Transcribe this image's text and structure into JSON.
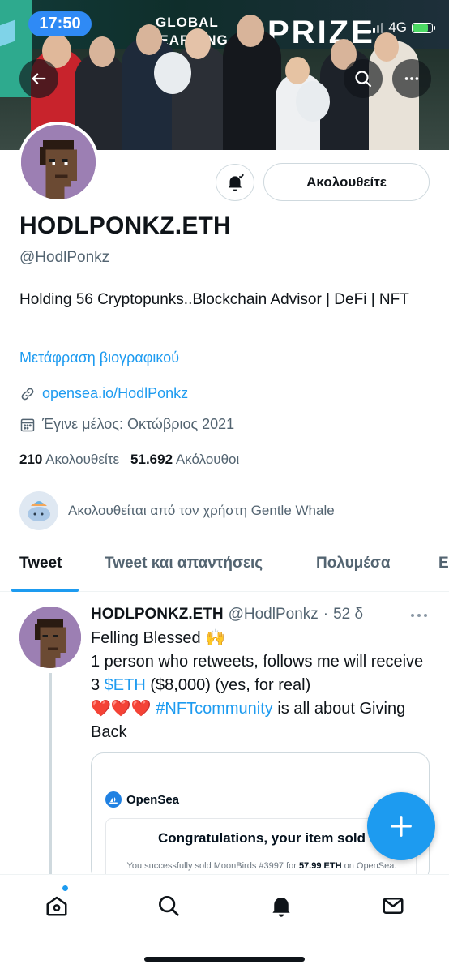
{
  "status": {
    "time": "17:50",
    "network": "4G"
  },
  "banner": {
    "text_global": "GLOBAL",
    "text_learning": "LEARNING",
    "text_prize": "PRIZE"
  },
  "profile": {
    "display_name": "HODLPONKZ.ETH",
    "handle": "@HodlPonkz",
    "bio": "Holding 56 Cryptopunks..Blockchain Advisor | DeFi | NFT",
    "translate_bio": "Μετάφραση βιογραφικού",
    "website": "opensea.io/HodlPonkz",
    "joined": "Έγινε μέλος: Οκτώβριος 2021",
    "following_count": "210",
    "following_label": "Ακολουθείτε",
    "followers_count": "51.692",
    "followers_label": "Ακόλουθοι",
    "followed_by": "Ακολουθείται από τον χρήστη Gentle Whale",
    "follow_button": "Ακολουθείτε"
  },
  "tabs": [
    {
      "label": "Tweet"
    },
    {
      "label": "Tweet και απαντήσεις"
    },
    {
      "label": "Πολυμέσα"
    },
    {
      "label": "Ει"
    }
  ],
  "tweet": {
    "author_name": "HODLPONKZ.ETH",
    "author_handle": "@HodlPonkz",
    "separator": "·",
    "time": "52 δ",
    "line1": "Felling Blessed 🙌",
    "line2": "1 person who retweets, follows me will receive 3",
    "cashtag": "$ETH",
    "line3": "($8,000) (yes, for real)",
    "hearts": "❤️❤️❤️",
    "hashtag": "#NFTcommunity",
    "line4": "is all about Giving Back",
    "card": {
      "brand": "OpenSea",
      "title": "Congratulations, your item sold",
      "sold_prefix": "You successfully sold MoonBirds #3997 for",
      "sold_amount": "57.99 ETH",
      "sold_suffix": "on OpenSea."
    }
  },
  "colors": {
    "accent": "#1d9bf0",
    "status_pill": "#2f8af5",
    "text_primary": "#0f1419",
    "text_secondary": "#536471",
    "avatar_bg": "#9c7fb3"
  },
  "icons": {
    "back": "arrow-left-icon",
    "search": "search-icon",
    "more": "more-icon",
    "bell": "bell-check-icon",
    "link": "link-icon",
    "calendar": "calendar-icon",
    "compose": "plus-icon",
    "nav_home": "home-icon",
    "nav_search": "search-icon",
    "nav_notifications": "bell-icon",
    "nav_messages": "mail-icon"
  }
}
